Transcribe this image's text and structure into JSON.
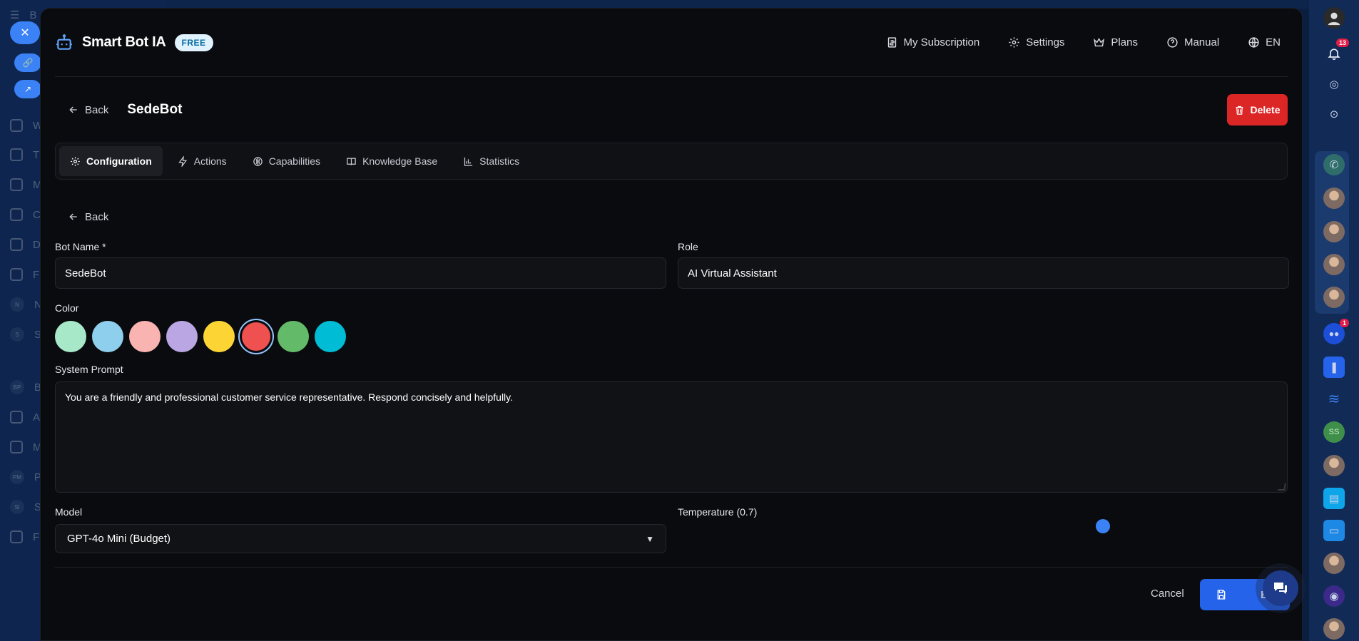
{
  "app": {
    "name": "Smart Bot IA",
    "plan_badge": "FREE"
  },
  "nav": {
    "subscription": "My Subscription",
    "settings": "Settings",
    "plans": "Plans",
    "manual": "Manual",
    "language": "EN"
  },
  "page": {
    "back_label": "Back",
    "title": "SedeBot",
    "delete_label": "Delete"
  },
  "tabs": [
    {
      "label": "Configuration",
      "icon": "gear-icon",
      "active": true
    },
    {
      "label": "Actions",
      "icon": "lightning-icon",
      "active": false
    },
    {
      "label": "Capabilities",
      "icon": "capabilities-icon",
      "active": false
    },
    {
      "label": "Knowledge Base",
      "icon": "book-icon",
      "active": false
    },
    {
      "label": "Statistics",
      "icon": "bar-chart-icon",
      "active": false
    }
  ],
  "form": {
    "back_label": "Back",
    "bot_name_label": "Bot Name *",
    "bot_name_value": "SedeBot",
    "role_label": "Role",
    "role_value": "AI Virtual Assistant",
    "color_label": "Color",
    "colors": [
      "#a7e8c8",
      "#8ecfee",
      "#f9b3b0",
      "#b9a6e3",
      "#fcd535",
      "#ef5050",
      "#63bb6a",
      "#00bcd4"
    ],
    "selected_color": "#ef5050",
    "system_prompt_label": "System Prompt",
    "system_prompt_value": "You are a friendly and professional customer service representative. Respond concisely and helpfully.",
    "model_label": "Model",
    "model_value": "GPT-4o Mini (Budget)",
    "temperature_label": "Temperature (0.7)",
    "temperature_value": 0.7
  },
  "footer": {
    "cancel_label": "Cancel",
    "save_label": "Bot"
  },
  "rail": {
    "notifications_count": "13",
    "chat_badge": "1",
    "avatar_initials": "SS"
  },
  "background": {
    "sidebar_letters": [
      "B",
      "W",
      "T",
      "M",
      "C",
      "D",
      "F",
      "N",
      "S",
      "B",
      "A",
      "M",
      "P",
      "S",
      "F"
    ],
    "sidebar_badge": "1",
    "small_avatars": [
      "N",
      "S",
      "BP",
      "PM",
      "SI"
    ]
  }
}
